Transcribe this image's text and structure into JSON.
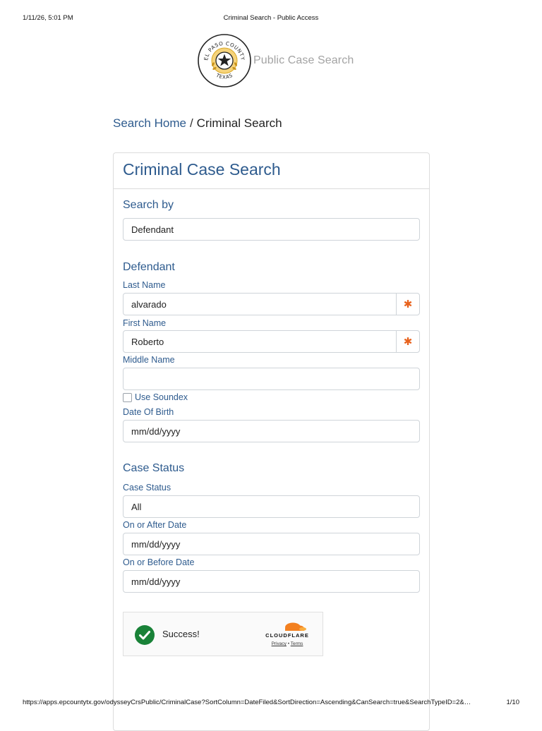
{
  "print_header": {
    "datetime": "1/11/26, 5:01 PM",
    "page_title": "Criminal Search - Public Access"
  },
  "brand": {
    "seal_top_text": "EL PASO COUNTY",
    "seal_bottom_text": "TEXAS",
    "site_name": "Public Case Search"
  },
  "breadcrumb": {
    "home": "Search Home",
    "separator": "/",
    "current": "Criminal Search"
  },
  "form": {
    "title": "Criminal Case Search",
    "search_by": {
      "heading": "Search by",
      "value": "Defendant"
    },
    "defendant": {
      "heading": "Defendant",
      "last_name_label": "Last Name",
      "last_name_value": "alvarado",
      "first_name_label": "First Name",
      "first_name_value": "Roberto",
      "middle_name_label": "Middle Name",
      "middle_name_value": "",
      "soundex_label": "Use Soundex",
      "soundex_checked": false,
      "dob_label": "Date Of Birth",
      "dob_placeholder": "mm/dd/yyyy",
      "required_marker": "✱"
    },
    "case_status": {
      "heading": "Case Status",
      "status_label": "Case Status",
      "status_value": "All",
      "after_label": "On or After Date",
      "after_placeholder": "mm/dd/yyyy",
      "before_label": "On or Before Date",
      "before_placeholder": "mm/dd/yyyy"
    },
    "captcha": {
      "status": "Success!",
      "provider": "CLOUDFLARE",
      "privacy_link": "Privacy",
      "link_separator": "•",
      "terms_link": "Terms",
      "success_color": "#198238",
      "brand_color": "#f38020"
    }
  },
  "print_footer": {
    "url": "https://apps.epcountytx.gov/odysseyCrsPublic/CriminalCase?SortColumn=DateFiled&SortDirection=Ascending&CanSearch=true&SearchTypeID=2&…",
    "page": "1/10"
  },
  "colors": {
    "link_blue": "#2e5b8e",
    "required_orange": "#e8621d",
    "brand_gray": "#a3a3a3"
  }
}
